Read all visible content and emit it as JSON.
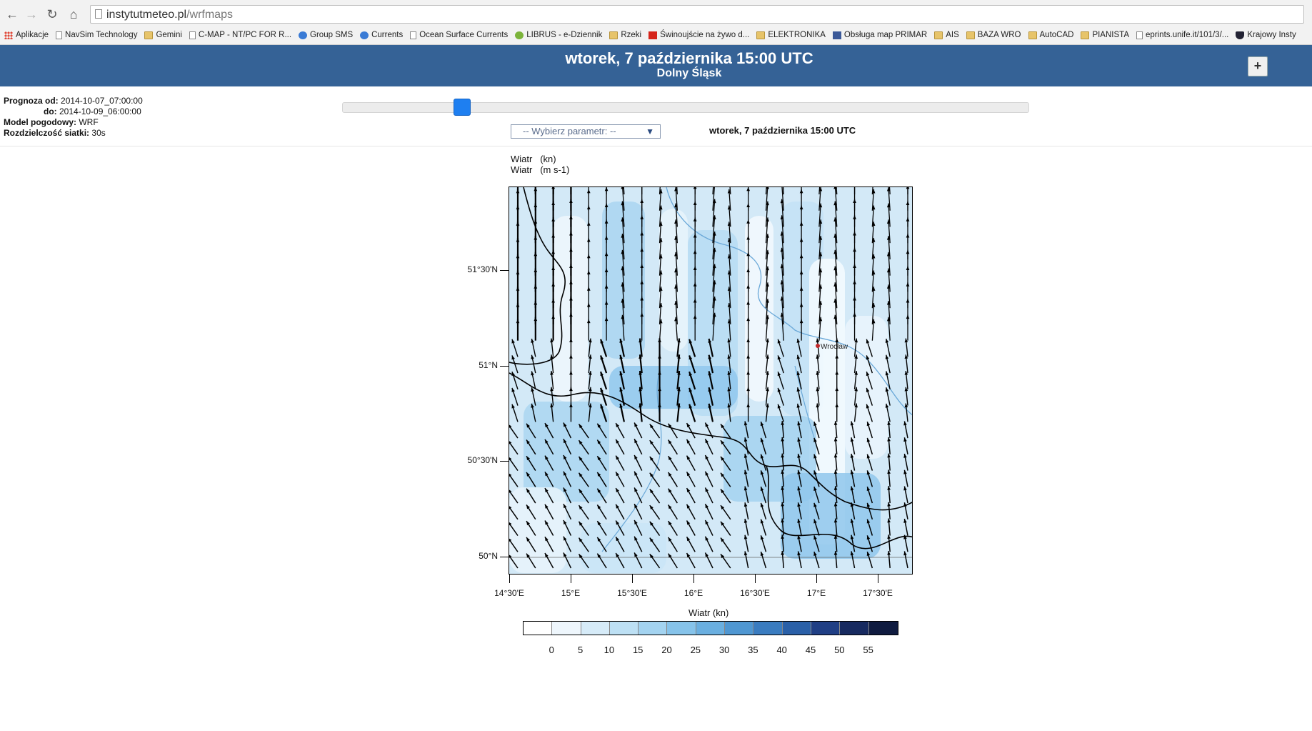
{
  "browser": {
    "url_host": "instytutmeteo.pl",
    "url_path": "/wrfmaps",
    "bookmarks": [
      {
        "label": "Aplikacje",
        "icon": "apps-icon"
      },
      {
        "label": "NavSim Technology",
        "icon": "page-icon"
      },
      {
        "label": "Gemini",
        "icon": "folder-icon"
      },
      {
        "label": "C-MAP - NT/PC FOR R...",
        "icon": "page-icon"
      },
      {
        "label": "Group SMS",
        "icon": "globe-icon"
      },
      {
        "label": "Currents",
        "icon": "noaa-icon"
      },
      {
        "label": "Ocean Surface Currents",
        "icon": "page-icon"
      },
      {
        "label": "LIBRUS - e-Dziennik",
        "icon": "librus-icon"
      },
      {
        "label": "Rzeki",
        "icon": "folder-icon"
      },
      {
        "label": "Świnoujście na żywo d...",
        "icon": "camera-icon"
      },
      {
        "label": "ELEKTRONIKA",
        "icon": "folder-icon"
      },
      {
        "label": "Obsługa map PRIMAR",
        "icon": "facebook-icon"
      },
      {
        "label": "AIS",
        "icon": "folder-icon"
      },
      {
        "label": "BAZA WRO",
        "icon": "folder-icon"
      },
      {
        "label": "AutoCAD",
        "icon": "folder-icon"
      },
      {
        "label": "PIANISTA",
        "icon": "folder-icon"
      },
      {
        "label": "eprints.unife.it/101/3/...",
        "icon": "page-icon"
      },
      {
        "label": "Krajowy Insty",
        "icon": "shield-icon"
      }
    ]
  },
  "header": {
    "title": "wtorek, 7 października 15:00 UTC",
    "subtitle": "Dolny Śląsk",
    "plus": "+"
  },
  "info": {
    "forecast_from_label": "Prognoza od:",
    "forecast_from": "2014-10-07_07:00:00",
    "forecast_to_label": "do:",
    "forecast_to": "2014-10-09_06:00:00",
    "model_label": "Model pogodowy:",
    "model": "WRF",
    "resolution_label": "Rozdzielczość siatki:",
    "resolution": "30s"
  },
  "controls": {
    "slider_position": 0.165,
    "param_select": "-- Wybierz parametr: --",
    "selected_time": "wtorek, 7 października 15:00 UTC"
  },
  "plot": {
    "var1": "Wiatr",
    "unit1": "(kn)",
    "var2": "Wiatr",
    "unit2": "(m s-1)",
    "city": "Wrocław",
    "y_ticks": [
      "51°30'N",
      "51°N",
      "50°30'N",
      "50°N"
    ],
    "x_ticks": [
      "14°30'E",
      "15°E",
      "15°30'E",
      "16°E",
      "16°30'E",
      "17°E",
      "17°30'E"
    ],
    "colorbar_title": "Wiatr  (kn)",
    "colorbar_labels": [
      "0",
      "5",
      "10",
      "15",
      "20",
      "25",
      "30",
      "35",
      "40",
      "45",
      "50",
      "55"
    ],
    "colorbar_colors": [
      "#ffffff",
      "#eef6fc",
      "#d6ebf8",
      "#bde0f4",
      "#a3d3f0",
      "#86c3ea",
      "#6aafe0",
      "#4f97d2",
      "#3a7cc0",
      "#2a60a8",
      "#203f85",
      "#172a60",
      "#0f1b40"
    ]
  }
}
